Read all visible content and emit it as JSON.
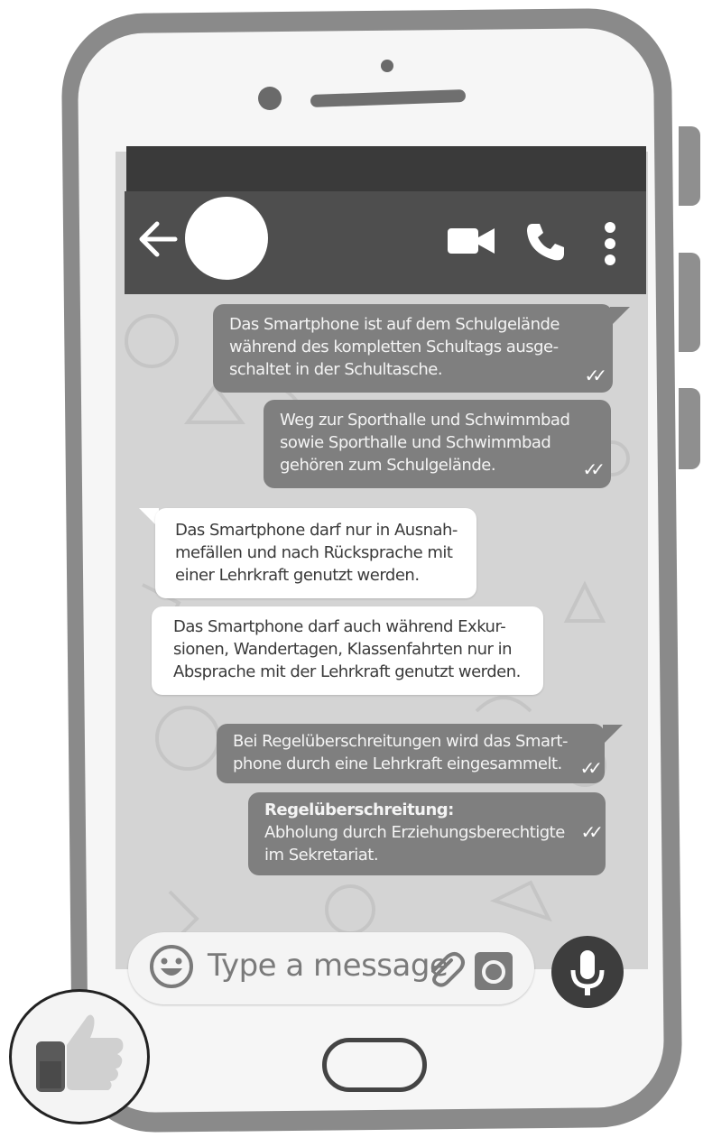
{
  "chat": {
    "messages": [
      {
        "direction": "outgoing",
        "lines": [
          "Das Smartphone ist auf dem Schulgelände",
          "während des kompletten Schultags ausge-",
          "schaltet in der Schultasche."
        ],
        "status": "read"
      },
      {
        "direction": "outgoing",
        "lines": [
          "Weg zur Sporthalle und Schwimmbad",
          "sowie Sporthalle und Schwimmbad",
          "gehören zum Schulgelände."
        ],
        "status": "read"
      },
      {
        "direction": "incoming",
        "lines": [
          "Das Smartphone darf nur in Ausnah-",
          "mefällen und nach Rücksprache mit",
          "einer Lehrkraft genutzt werden."
        ]
      },
      {
        "direction": "incoming",
        "lines": [
          "Das Smartphone darf auch während Exkur-",
          "sionen, Wandertagen, Klassenfahrten nur in",
          "Absprache mit der Lehrkraft genutzt werden."
        ]
      },
      {
        "direction": "outgoing",
        "lines": [
          "Bei Regelüberschreitungen wird das Smart-",
          "phone durch eine Lehrkraft eingesammelt."
        ],
        "status": "read"
      },
      {
        "direction": "outgoing",
        "heading": "Regelüberschreitung:",
        "lines": [
          "Abholung durch Erziehungsberechtigte",
          "im Sekretariat."
        ],
        "status": "read"
      }
    ]
  },
  "composer": {
    "placeholder": "Type a message"
  },
  "icons": {
    "back": "arrow-left-icon",
    "video": "video-camera-icon",
    "call": "phone-icon",
    "menu": "more-vertical-icon",
    "emoji": "emoji-icon",
    "attach": "paperclip-icon",
    "camera": "camera-icon",
    "mic": "microphone-icon",
    "read": "double-check-icon",
    "badge": "thumbs-up-icon"
  },
  "colors": {
    "header": "#4e4e4e",
    "status_bar": "#3a3a3a",
    "outgoing_bubble": "#7f7f7f",
    "incoming_bubble": "#ffffff",
    "chat_bg": "#d4d4d4"
  }
}
